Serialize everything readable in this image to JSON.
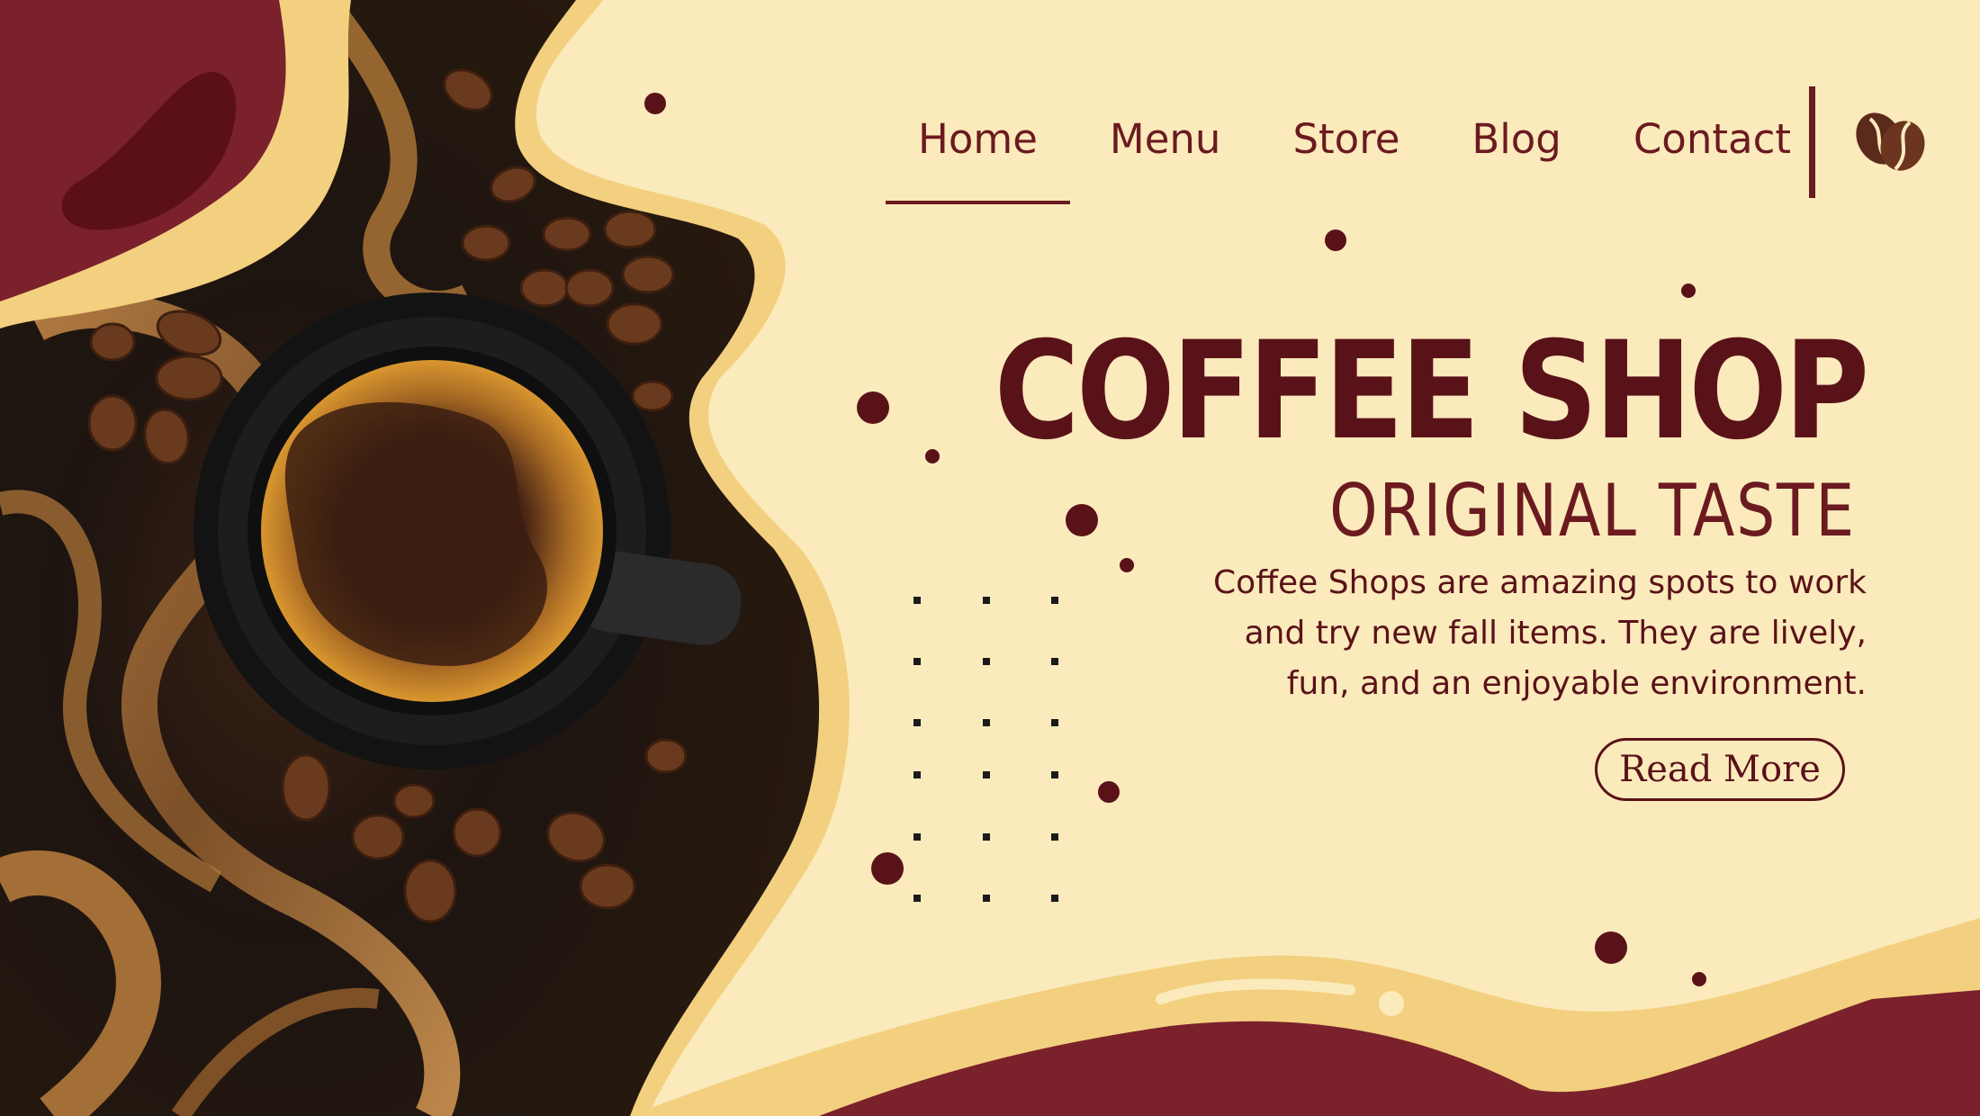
{
  "nav": {
    "items": [
      {
        "label": "Home",
        "active": true
      },
      {
        "label": "Menu",
        "active": false
      },
      {
        "label": "Store",
        "active": false
      },
      {
        "label": "Blog",
        "active": false
      },
      {
        "label": "Contact",
        "active": false
      }
    ],
    "logo_icon": "coffee-bean-icon"
  },
  "hero": {
    "title": "COFFEE SHOP",
    "subtitle": "ORIGINAL TASTE",
    "description_lines": [
      "Coffee Shops are amazing spots to work",
      "and try new fall items. They are lively,",
      "fun, and an enjoyable environment."
    ],
    "cta_label": "Read More"
  },
  "colors": {
    "background": "#fbeabb",
    "accent_dark": "#6b1a20",
    "maroon": "#7b212c",
    "cream_gold": "#f3d07f"
  }
}
